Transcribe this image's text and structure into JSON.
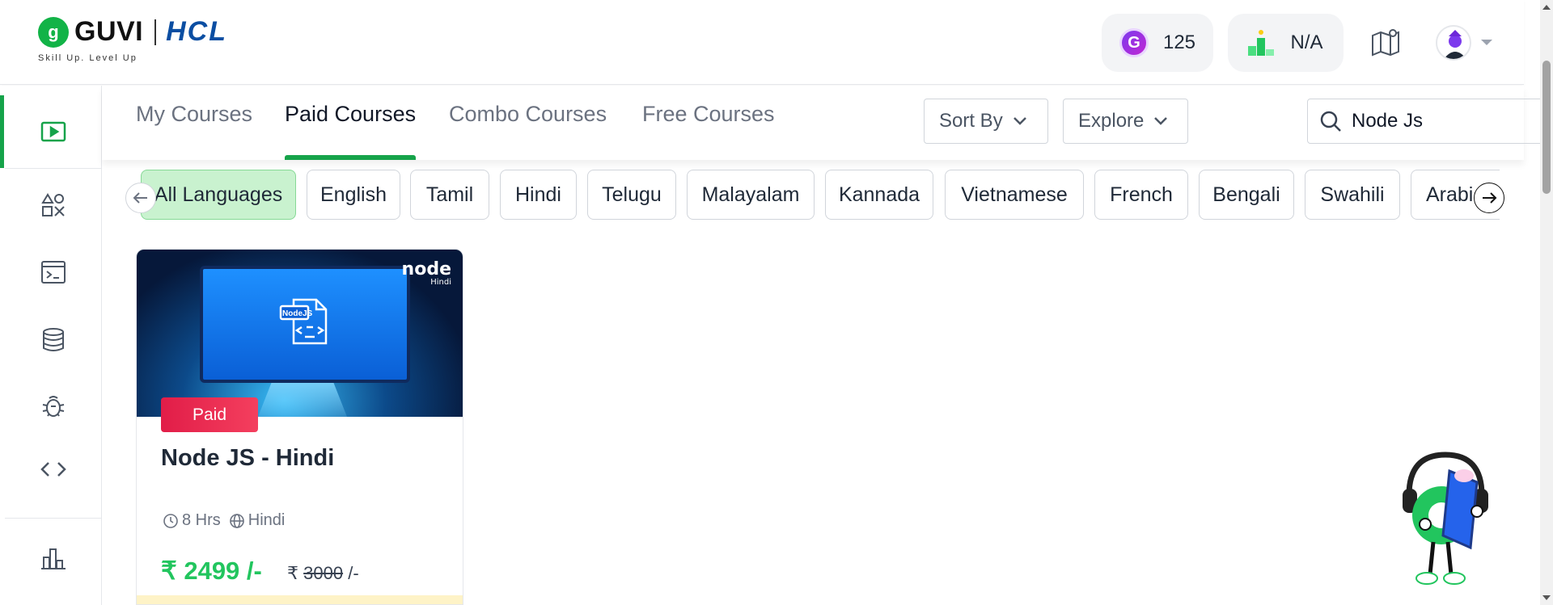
{
  "header": {
    "brand_name": "GUVI",
    "brand_partner": "HCL",
    "tagline": "Skill Up. Level Up",
    "coins": "125",
    "rank": "N/A"
  },
  "sidebar": {
    "items": [
      {
        "icon": "play-video-icon",
        "active": true
      },
      {
        "icon": "shapes-icon",
        "active": false
      },
      {
        "icon": "terminal-icon",
        "active": false
      },
      {
        "icon": "database-icon",
        "active": false
      },
      {
        "icon": "bug-icon",
        "active": false
      },
      {
        "icon": "code-icon",
        "active": false
      },
      {
        "icon": "bar-chart-icon",
        "active": false
      }
    ]
  },
  "tabs": [
    {
      "label": "My Courses",
      "active": false
    },
    {
      "label": "Paid Courses",
      "active": true
    },
    {
      "label": "Combo Courses",
      "active": false
    },
    {
      "label": "Free Courses",
      "active": false
    }
  ],
  "controls": {
    "sort_label": "Sort By",
    "explore_label": "Explore",
    "search_value": "Node Js"
  },
  "languages": [
    {
      "label": "All Languages",
      "active": true
    },
    {
      "label": "English",
      "active": false
    },
    {
      "label": "Tamil",
      "active": false
    },
    {
      "label": "Hindi",
      "active": false
    },
    {
      "label": "Telugu",
      "active": false
    },
    {
      "label": "Malayalam",
      "active": false
    },
    {
      "label": "Kannada",
      "active": false
    },
    {
      "label": "Vietnamese",
      "active": false
    },
    {
      "label": "French",
      "active": false
    },
    {
      "label": "Bengali",
      "active": false
    },
    {
      "label": "Swahili",
      "active": false
    },
    {
      "label": "Arabic",
      "active": false
    }
  ],
  "course": {
    "thumbnail_brand": "node",
    "thumbnail_lang": "Hindi",
    "thumbnail_file_label": "NodeJS",
    "badge": "Paid",
    "title": "Node JS - Hindi",
    "duration": "8 Hrs",
    "language": "Hindi",
    "price": "₹ 2499 /-",
    "original_price_symbol": "₹",
    "original_price": "3000",
    "original_price_suffix": "/-"
  },
  "colors": {
    "accent": "#16a34a",
    "active_chip_bg": "#c9f2cf",
    "price_green": "#22c55e",
    "paid_badge": "#e11d48",
    "brand_blue": "#0b4ea2"
  }
}
